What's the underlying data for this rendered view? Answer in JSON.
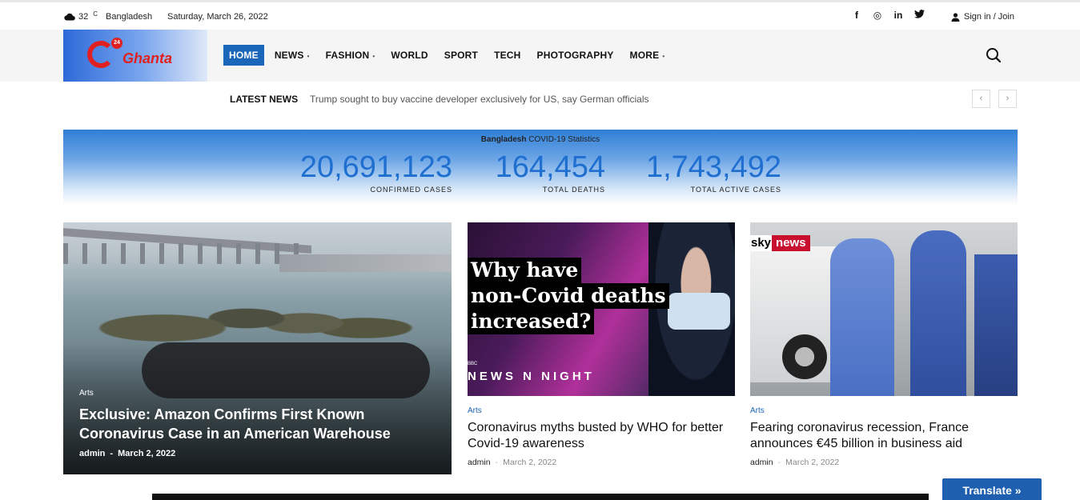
{
  "topbar": {
    "weather_temp": "32",
    "weather_unit": "C",
    "weather_location": "Bangladesh",
    "date": "Saturday, March 26, 2022",
    "socials": [
      {
        "icon": "facebook-icon",
        "glyph": "f"
      },
      {
        "icon": "instagram-icon",
        "glyph": "◎"
      },
      {
        "icon": "linkedin-icon",
        "glyph": "in"
      },
      {
        "icon": "twitter-icon",
        "glyph": "🐦"
      }
    ],
    "signin_label": "Sign in / Join"
  },
  "logo": {
    "badge": "24",
    "brand": "Ghanta"
  },
  "nav": {
    "items": [
      {
        "label": "HOME",
        "active": true,
        "dropdown": false
      },
      {
        "label": "NEWS",
        "active": false,
        "dropdown": true
      },
      {
        "label": "FASHION",
        "active": false,
        "dropdown": true
      },
      {
        "label": "WORLD",
        "active": false,
        "dropdown": false
      },
      {
        "label": "SPORT",
        "active": false,
        "dropdown": false
      },
      {
        "label": "TECH",
        "active": false,
        "dropdown": false
      },
      {
        "label": "PHOTOGRAPHY",
        "active": false,
        "dropdown": false
      },
      {
        "label": "MORE",
        "active": false,
        "dropdown": true
      }
    ]
  },
  "ticker": {
    "label": "LATEST NEWS",
    "headline": "Trump sought to buy vaccine developer exclusively for US, say German officials",
    "prev": "‹",
    "next": "›"
  },
  "covid": {
    "country": "Bangladesh",
    "title_suffix": "COVID-19 Statistics",
    "stats": [
      {
        "value": "20,691,123",
        "label": "CONFIRMED CASES"
      },
      {
        "value": "164,454",
        "label": "TOTAL DEATHS"
      },
      {
        "value": "1,743,492",
        "label": "TOTAL ACTIVE CASES"
      }
    ]
  },
  "featured": {
    "category": "Arts",
    "headline": "Exclusive: Amazon Confirms First Known Coronavirus Case in an American Warehouse",
    "author": "admin",
    "date": "March 2, 2022"
  },
  "cards": [
    {
      "category": "Arts",
      "headline": "Coronavirus myths busted by WHO for better Covid-19 awareness",
      "author": "admin",
      "date": "March 2, 2022",
      "image_text": [
        "Why have",
        "non-Covid deaths",
        "increased?"
      ],
      "image_brand": "NEWS N NIGHT",
      "image_bbc": "BBC"
    },
    {
      "category": "Arts",
      "headline": "Fearing coronavirus recession, France announces €45 billion in business aid",
      "author": "admin",
      "date": "March 2, 2022",
      "image_brand_a": "sky",
      "image_brand_b": "news"
    }
  ],
  "translate_label": "Translate »",
  "colors": {
    "accent": "#1a66b8",
    "stat_number": "#1f6fd0",
    "translate_bg": "#1f5fb0"
  }
}
